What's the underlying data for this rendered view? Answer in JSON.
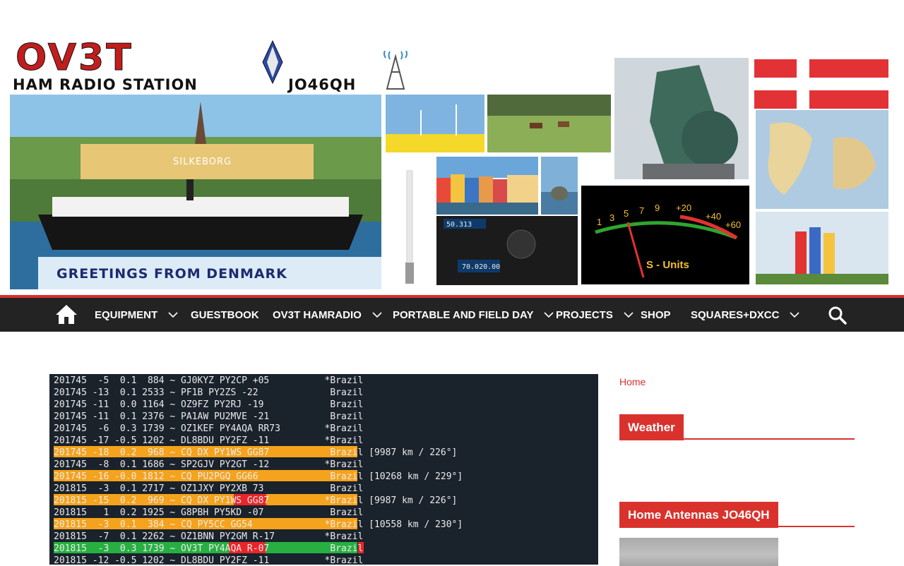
{
  "banner": {
    "logo": "OV3T",
    "station": "HAM RADIO STATION",
    "locator": "JO46QH",
    "greeting": "GREETINGS FROM DENMARK",
    "town": "SILKEBORG",
    "meter_scale": [
      "1",
      "3",
      "5",
      "7",
      "9",
      "+20",
      "+40",
      "+60"
    ],
    "meter_label": "S - Units",
    "radio_display_1": "50.313",
    "radio_display_2": "70.020.00"
  },
  "nav": {
    "items": [
      {
        "label": "EQUIPMENT",
        "has_submenu": true
      },
      {
        "label": "GUESTBOOK",
        "has_submenu": false
      },
      {
        "label": "OV3T HAMRADIO",
        "has_submenu": true
      },
      {
        "label": "PORTABLE AND FIELD DAY",
        "has_submenu": true
      },
      {
        "label": "PROJECTS",
        "has_submenu": true
      },
      {
        "label": "SHOP",
        "has_submenu": false
      },
      {
        "label": "SQUARES+DXCC",
        "has_submenu": true
      }
    ]
  },
  "terminal": {
    "lines": [
      {
        "text": "201745  -5  0.1  884 ~ GJ0KYZ PY2CP +05          *Brazil",
        "hl": "none"
      },
      {
        "text": "201745 -13  0.1 2533 ~ PF1B PY2ZS -22             Brazil",
        "hl": "none"
      },
      {
        "text": "201745 -11  0.0 1164 ~ OZ9FZ PY2RJ -19            Brazil",
        "hl": "none"
      },
      {
        "text": "201745 -11  0.1 2376 ~ PA1AW PU2MVE -21           Brazil",
        "hl": "none"
      },
      {
        "text": "201745  -6  0.3 1739 ~ OZ1KEF PY4AQA RR73        *Brazil",
        "hl": "none"
      },
      {
        "text": "201745 -17 -0.5 1202 ~ DL8BDU PY2FZ -11          *Brazil",
        "hl": "none"
      },
      {
        "text": "201745 -18  0.2  968 ~ CQ DX PY1WS GG87           Brazil [9987 km / 226°]",
        "hl": "orange"
      },
      {
        "text": "201745  -8  0.1 1686 ~ SP2GJV PY2GT -12          *Brazil",
        "hl": "none"
      },
      {
        "text": "201745 -16 -0.0 1812 ~ CQ PU2PGQ GG66             Brazil [10268 km / 229°]",
        "hl": "orange"
      },
      {
        "text": "201815  -3  0.1 2717 ~ OZ1JXY PY2XB 73            Brazil",
        "hl": "none"
      },
      {
        "text": "201815 -15  0.2  969 ~ CQ DX PY1WS GG87          *Brazil [9987 km / 226°]",
        "hl": "orange-red"
      },
      {
        "text": "201815   1  0.2 1925 ~ G8PBH PY5KD -07            Brazil",
        "hl": "none"
      },
      {
        "text": "201815  -3  0.1  384 ~ CQ PY5CC GG54             *Brazil [10558 km / 230°]",
        "hl": "orange"
      },
      {
        "text": "201815  -7  0.1 2262 ~ OZ1BNN PY2GM R-17         *Brazil",
        "hl": "none"
      },
      {
        "text": "201815  -3  0.3 1739 ~ OV3T PY4AQA R-07           Brazil",
        "hl": "green"
      },
      {
        "text": "201815 -12 -0.5 1202 ~ DL8BDU PY2FZ -11          *Brazil",
        "hl": "none"
      }
    ]
  },
  "sidebar": {
    "breadcrumb": "Home",
    "widgets": [
      {
        "title": "Weather"
      },
      {
        "title": "Home Antennas JO46QH"
      }
    ]
  },
  "colors": {
    "accent": "#d9322d",
    "nav_bg": "#232323",
    "terminal_bg": "#1a222c",
    "highlight_orange": "#f5a21c",
    "highlight_green": "#27b041",
    "highlight_red": "#e8262a"
  },
  "icons": {
    "home": "home-icon",
    "search": "search-icon",
    "submenu": "chevron-down-icon"
  }
}
